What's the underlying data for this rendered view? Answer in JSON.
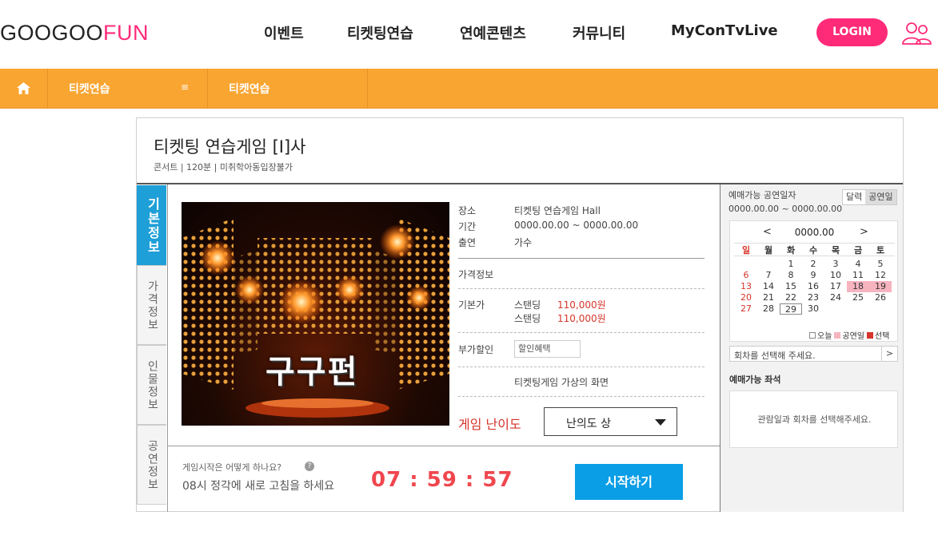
{
  "header": {
    "logo_main": "GOOGOO",
    "logo_accent": "FUN",
    "nav": [
      "이벤트",
      "티켓팅연습",
      "연예콘텐츠",
      "커뮤니티",
      "MyConTvLive"
    ],
    "login_label": "LOGIN"
  },
  "breadcrumb": {
    "crumb1": "티켓연습",
    "crumb1_menu": "≡",
    "crumb2": "티켓연습"
  },
  "show": {
    "title": "티켓팅 연습게임 [I]사",
    "meta": "콘서트 | 120분 | 미취학아동입장불가",
    "poster_text": "구구펀"
  },
  "side_tabs": [
    "기본정보",
    "가격정보",
    "인물정보",
    "공연정보"
  ],
  "info": {
    "venue_label": "장소",
    "venue_value": "티켓팅 연습게임 Hall",
    "period_label": "기간",
    "period_value": "0000.00.00 ~ 0000.00.00",
    "cast_label": "출연",
    "cast_value": "가수",
    "price_info_label": "가격정보",
    "base_price_label": "기본가",
    "prices": [
      {
        "seat": "스탠딩",
        "price": "110,000원"
      },
      {
        "seat": "스탠딩",
        "price": "110,000원"
      }
    ],
    "discount_label": "부가할인",
    "discount_box": "할인혜택",
    "note": "티켓팅게임 가상의 화면",
    "difficulty_label": "게임 난이도",
    "difficulty_value": "난의도 상"
  },
  "bottom": {
    "help_question": "게임시작은 어떻게 하나요?",
    "help_icon": "?",
    "help_note": "08시 정각에 새로 고침을 하세요",
    "countdown": "07 : 59 : 57",
    "start_label": "시작하기"
  },
  "calendar": {
    "title": "예매가능 공연일자",
    "range": "0000.00.00 ~ 0000.00.00",
    "toggle": [
      "달력",
      "공연일"
    ],
    "month": "0000.00",
    "prev": "<",
    "next": ">",
    "weekdays": [
      "일",
      "월",
      "화",
      "수",
      "목",
      "금",
      "토"
    ],
    "weeks": [
      [
        "",
        "",
        "1",
        "2",
        "3",
        "4",
        "5"
      ],
      [
        "6",
        "7",
        "8",
        "9",
        "10",
        "11",
        "12"
      ],
      [
        "13",
        "14",
        "15",
        "16",
        "17",
        "18",
        "19"
      ],
      [
        "20",
        "21",
        "22",
        "23",
        "24",
        "25",
        "26"
      ],
      [
        "27",
        "28",
        "29",
        "30",
        "",
        "",
        ""
      ]
    ],
    "performance_days": [
      "18",
      "19"
    ],
    "today": "29",
    "legend": {
      "today": "오늘",
      "performance": "공연일",
      "selected": "선택"
    },
    "round_placeholder": "회차를 선택해 주세요.",
    "round_arrow": ">",
    "seat_label": "예매가능 좌석",
    "seat_message": "관람일과 회차를 선택해주세요."
  },
  "colors": {
    "brand_pink": "#ff2b79",
    "nav_orange": "#f9a531",
    "accent_blue": "#0a9ee6",
    "price_red": "#d6352b",
    "performance_pink": "#f6b4bf"
  }
}
